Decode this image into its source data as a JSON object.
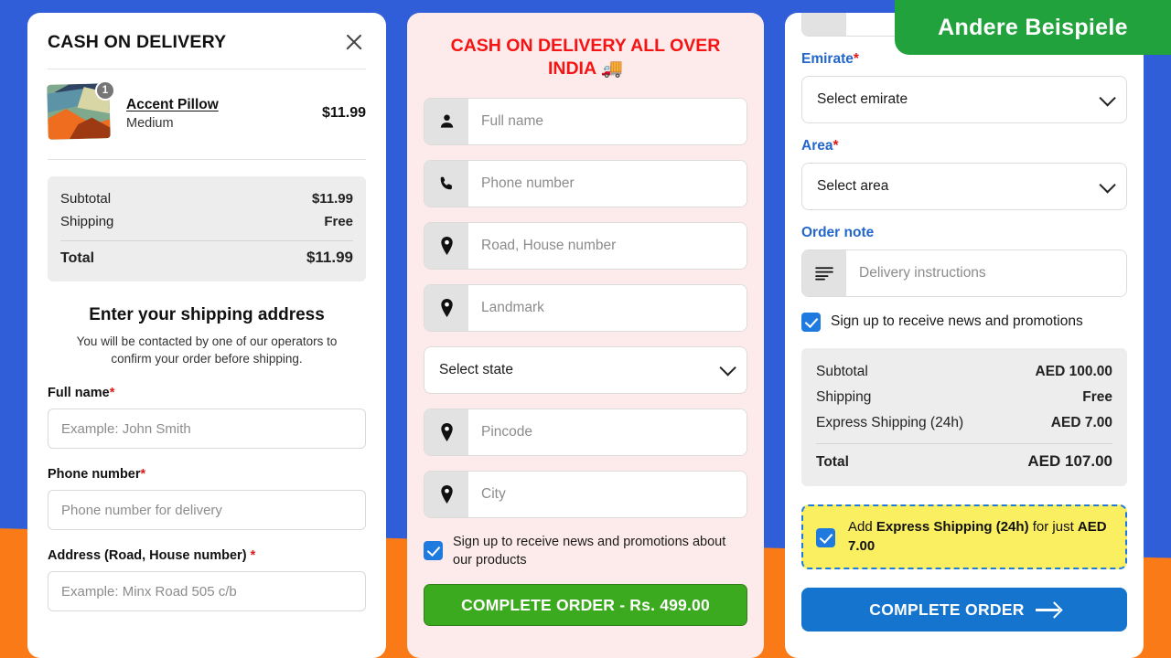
{
  "background": {
    "blue": "#2f5ed8",
    "orange": "#fb7a18"
  },
  "banner": {
    "label": "Andere Beispiele",
    "color": "#21a23c"
  },
  "panel1": {
    "title": "CASH ON DELIVERY",
    "close_icon": "close-icon",
    "line_item": {
      "name": "Accent Pillow",
      "variant": "Medium",
      "price": "$11.99",
      "quantity": "1"
    },
    "totals": [
      {
        "label": "Subtotal",
        "value": "$11.99"
      },
      {
        "label": "Shipping",
        "value": "Free"
      }
    ],
    "grand_total": {
      "label": "Total",
      "value": "$11.99"
    },
    "section_title": "Enter your shipping address",
    "section_sub": "You will be contacted by one of our operators to confirm your order before shipping.",
    "fields": [
      {
        "label": "Full name",
        "required": "*",
        "placeholder": "Example: John Smith"
      },
      {
        "label": "Phone number",
        "required": "*",
        "placeholder": "Phone number for delivery"
      },
      {
        "label": "Address (Road, House number)",
        "required": "*",
        "placeholder": "Example: Minx Road 505 c/b"
      }
    ]
  },
  "panel2": {
    "title": "CASH ON DELIVERY ALL OVER INDIA 🚚",
    "title_color": "#f51313",
    "fields": [
      {
        "icon": "person-icon",
        "placeholder": "Full name"
      },
      {
        "icon": "phone-icon",
        "placeholder": "Phone number"
      },
      {
        "icon": "location-pin-icon",
        "placeholder": "Road, House number"
      },
      {
        "icon": "location-pin-icon",
        "placeholder": "Landmark"
      }
    ],
    "state_select": {
      "value": "Select state",
      "icon": "chevron-down-icon"
    },
    "fields2": [
      {
        "icon": "location-pin-icon",
        "placeholder": "Pincode"
      },
      {
        "icon": "location-pin-icon",
        "placeholder": "City"
      }
    ],
    "newsletter": {
      "checked": true,
      "label": "Sign up to receive news and promotions about our products"
    },
    "submit": {
      "label": "COMPLETE ORDER - Rs. 499.00",
      "color": "#3caa1e"
    }
  },
  "panel3": {
    "emirate": {
      "label": "Emirate",
      "required": "*",
      "value": "Select emirate",
      "icon": "chevron-down-icon"
    },
    "area": {
      "label": "Area",
      "required": "*",
      "value": "Select area",
      "icon": "chevron-down-icon"
    },
    "order_note": {
      "label": "Order note",
      "icon": "note-lines-icon",
      "placeholder": "Delivery instructions"
    },
    "newsletter": {
      "checked": true,
      "label": "Sign up to receive news and promotions"
    },
    "totals": [
      {
        "label": "Subtotal",
        "value": "AED 100.00"
      },
      {
        "label": "Shipping",
        "value": "Free"
      },
      {
        "label": "Express Shipping (24h)",
        "value": "AED 7.00"
      }
    ],
    "grand_total": {
      "label": "Total",
      "value": "AED 107.00"
    },
    "promo": {
      "checked": true,
      "prefix": "Add ",
      "bold1": "Express Shipping (24h)",
      "middle": " for just ",
      "bold2": "AED 7.00",
      "bg": "#faee61",
      "border": "#1f7ae0"
    },
    "submit": {
      "label": "COMPLETE ORDER",
      "icon": "arrow-right-icon",
      "color": "#1574cd"
    }
  }
}
